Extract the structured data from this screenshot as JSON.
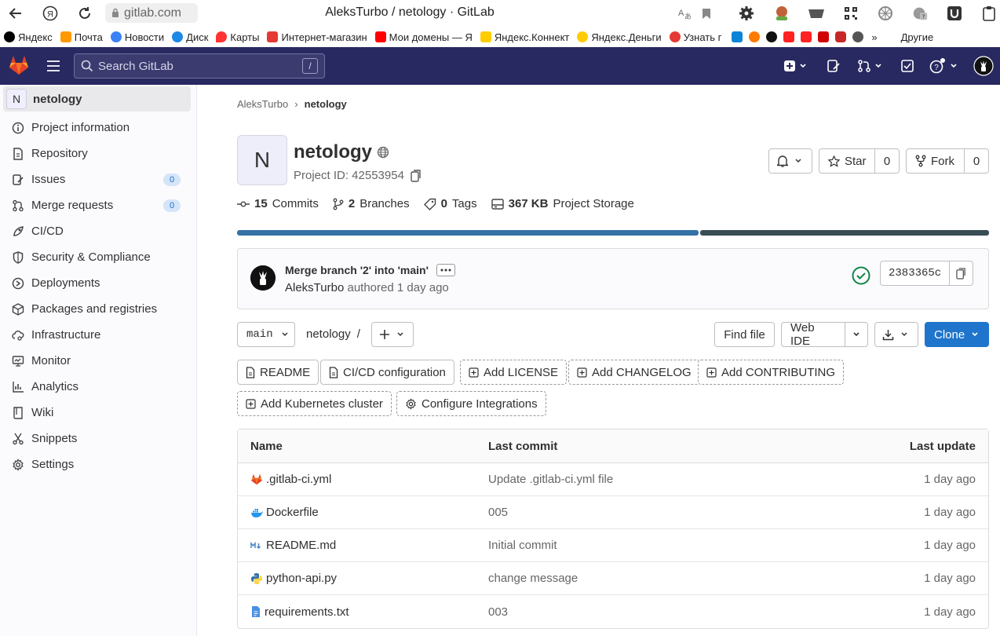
{
  "browser": {
    "url": "gitlab.com",
    "window_title": "AleksTurbo / netology · GitLab",
    "bookmarks": [
      {
        "label": "Яндекс",
        "color": "#000000"
      },
      {
        "label": "Почта",
        "color": "#ff9900"
      },
      {
        "label": "Новости",
        "color": "#3b82f6"
      },
      {
        "label": "Диск",
        "color": "#1e88e5"
      },
      {
        "label": "Карты",
        "color": "#ff3333"
      },
      {
        "label": "Интернет-магазин",
        "color": "#e53935"
      },
      {
        "label": "Мои домены — Я",
        "color": "#ff0000"
      },
      {
        "label": "Яндекс.Коннект",
        "color": "#ffcc00"
      },
      {
        "label": "Яндекс.Деньги",
        "color": "#ffcc00"
      },
      {
        "label": "Узнать г",
        "color": "#e53935"
      }
    ],
    "bookmarks_overflow": "»",
    "bookmarks_other": "Другие"
  },
  "header": {
    "search_placeholder": "Search GitLab",
    "search_shortcut": "/",
    "bg_color": "#292961"
  },
  "sidebar": {
    "project_initial": "N",
    "project_name": "netology",
    "items": [
      {
        "label": "Project information",
        "icon": "info-icon"
      },
      {
        "label": "Repository",
        "icon": "doc-icon"
      },
      {
        "label": "Issues",
        "icon": "issues-icon",
        "badge": "0"
      },
      {
        "label": "Merge requests",
        "icon": "merge-request-icon",
        "badge": "0"
      },
      {
        "label": "CI/CD",
        "icon": "rocket-icon"
      },
      {
        "label": "Security & Compliance",
        "icon": "shield-icon"
      },
      {
        "label": "Deployments",
        "icon": "deployments-icon"
      },
      {
        "label": "Packages and registries",
        "icon": "package-icon"
      },
      {
        "label": "Infrastructure",
        "icon": "cloud-gear-icon"
      },
      {
        "label": "Monitor",
        "icon": "monitor-icon"
      },
      {
        "label": "Analytics",
        "icon": "chart-icon"
      },
      {
        "label": "Wiki",
        "icon": "book-icon"
      },
      {
        "label": "Snippets",
        "icon": "scissors-icon"
      },
      {
        "label": "Settings",
        "icon": "gear-icon"
      }
    ]
  },
  "main": {
    "breadcrumb": {
      "owner": "AleksTurbo",
      "separator": "›",
      "project": "netology"
    },
    "project_initial": "N",
    "title": "netology",
    "project_id": "Project ID: 42553954",
    "notify_button": "",
    "star_label": "Star",
    "star_count": "0",
    "fork_label": "Fork",
    "fork_count": "0",
    "stats": {
      "commits_count": "15",
      "commits_label": "Commits",
      "branches_count": "2",
      "branches_label": "Branches",
      "tags_count": "0",
      "tags_label": "Tags",
      "storage_count": "367 KB",
      "storage_label": "Project Storage"
    },
    "language_bar": [
      {
        "color": "#3572a5",
        "fraction": 0.615
      },
      {
        "color": "#384d54",
        "fraction": 0.385
      }
    ],
    "commit": {
      "title": "Merge branch '2' into 'main'",
      "author": "AleksTurbo",
      "action": "authored 1 day ago",
      "sha": "2383365c",
      "status_color": "#108548"
    },
    "toolbar": {
      "branch": "main",
      "path_project": "netology",
      "path_sep": "/",
      "find_file": "Find file",
      "web_ide": "Web IDE",
      "clone": "Clone",
      "clone_color": "#1f75cb"
    },
    "quick_links": {
      "readme": "README",
      "cicd": "CI/CD configuration",
      "license": "Add LICENSE",
      "changelog": "Add CHANGELOG",
      "contributing": "Add CONTRIBUTING",
      "kubernetes": "Add Kubernetes cluster",
      "integrations": "Configure Integrations"
    },
    "table": {
      "headers": {
        "name": "Name",
        "last_commit": "Last commit",
        "last_update": "Last update"
      },
      "rows": [
        {
          "name": ".gitlab-ci.yml",
          "icon": "gitlab-icon",
          "commit": "Update .gitlab-ci.yml file",
          "date": "1 day ago"
        },
        {
          "name": "Dockerfile",
          "icon": "docker-icon",
          "commit": "005",
          "date": "1 day ago"
        },
        {
          "name": "README.md",
          "icon": "markdown-icon",
          "commit": "Initial commit",
          "date": "1 day ago"
        },
        {
          "name": "python-api.py",
          "icon": "python-icon",
          "commit": "change message",
          "date": "1 day ago"
        },
        {
          "name": "requirements.txt",
          "icon": "text-file-icon",
          "commit": "003",
          "date": "1 day ago"
        }
      ]
    }
  }
}
